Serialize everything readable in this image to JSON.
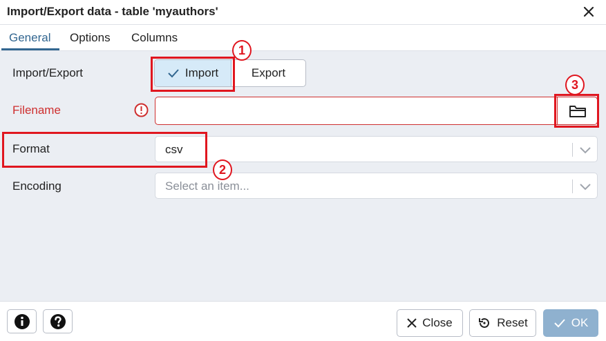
{
  "dialog": {
    "title": "Import/Export data - table 'myauthors'"
  },
  "tabs": [
    {
      "label": "General"
    },
    {
      "label": "Options"
    },
    {
      "label": "Columns"
    }
  ],
  "form": {
    "import_export_label": "Import/Export",
    "import_label": "Import",
    "export_label": "Export",
    "filename_label": "Filename",
    "filename_value": "",
    "format_label": "Format",
    "format_value": "csv",
    "encoding_label": "Encoding",
    "encoding_placeholder": "Select an item..."
  },
  "footer": {
    "close_label": "Close",
    "reset_label": "Reset",
    "ok_label": "OK"
  },
  "annotations": {
    "badge_1": "1",
    "badge_2": "2",
    "badge_3": "3"
  },
  "colors": {
    "accent": "#326690",
    "error": "#ce2e2e",
    "annotation": "#e0161f",
    "ok_button": "#8fb1cf"
  },
  "icons": [
    "close-icon",
    "check-icon",
    "error-icon",
    "folder-icon",
    "chevron-down-icon",
    "info-icon",
    "help-icon",
    "reset-icon"
  ]
}
